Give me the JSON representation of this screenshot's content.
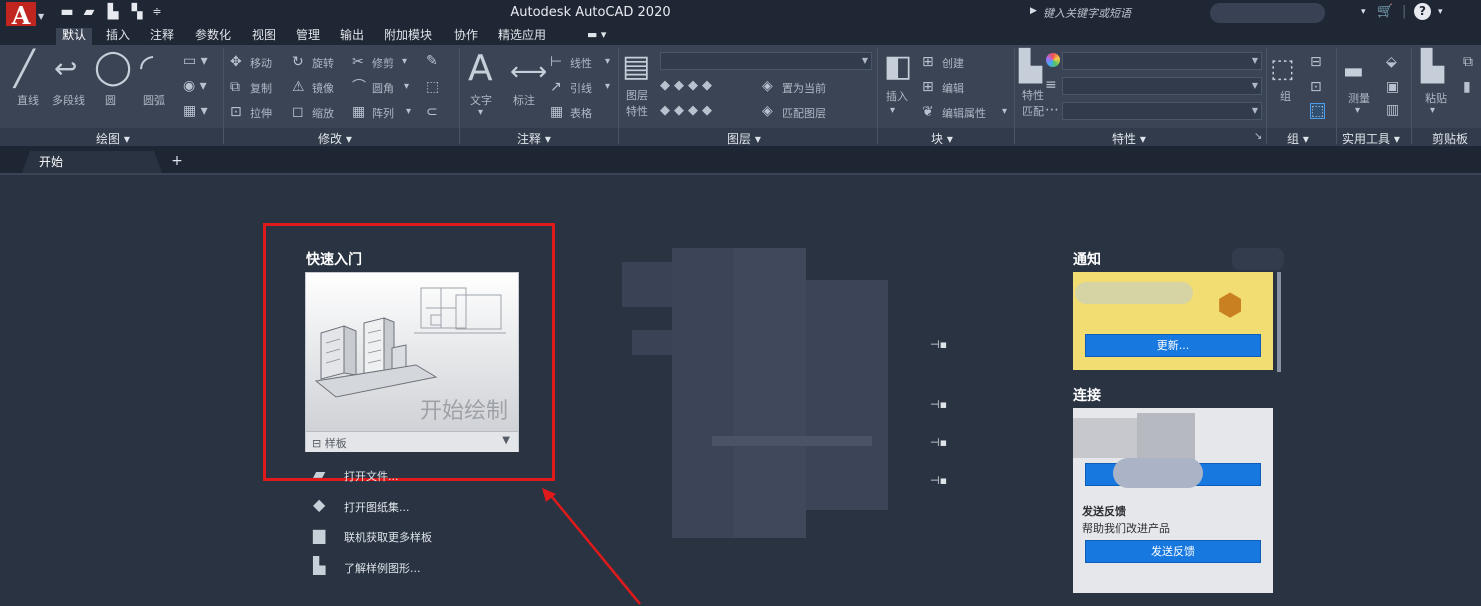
{
  "app": {
    "logo_letter": "A",
    "title": "Autodesk AutoCAD 2020",
    "search_placeholder": "键入关键字或短语"
  },
  "ribbon_tabs": [
    "默认",
    "插入",
    "注释",
    "参数化",
    "视图",
    "管理",
    "输出",
    "附加模块",
    "协作",
    "精选应用"
  ],
  "ribbon": {
    "draw": {
      "title": "绘图 ▾",
      "items": [
        "直线",
        "多段线",
        "圆",
        "圆弧"
      ]
    },
    "modify": {
      "title": "修改 ▾",
      "items": [
        "移动",
        "旋转",
        "修剪",
        "复制",
        "镜像",
        "圆角",
        "拉伸",
        "缩放",
        "阵列"
      ]
    },
    "annotation": {
      "title": "注释 ▾",
      "items": [
        "文字",
        "标注",
        "线性",
        "引线",
        "表格"
      ]
    },
    "layers": {
      "title": "图层 ▾",
      "items": [
        "图层特性",
        "置为当前",
        "匹配图层"
      ]
    },
    "block": {
      "title": "块 ▾",
      "items": [
        "插入",
        "创建",
        "编辑",
        "编辑属性"
      ]
    },
    "properties": {
      "title": "特性 ▾",
      "items": [
        "特性匹配"
      ]
    },
    "groups": {
      "title": "组 ▾",
      "items": [
        "组"
      ]
    },
    "utilities": {
      "title": "实用工具 ▾",
      "items": [
        "测量"
      ]
    },
    "clipboard": {
      "title": "剪贴板",
      "items": [
        "粘贴"
      ]
    }
  },
  "doc_tab": {
    "label": "开始",
    "add": "+"
  },
  "start": {
    "section_title": "快速入门",
    "start_drawing": "开始绘制",
    "template_label": "样板",
    "links": [
      "打开文件...",
      "打开图纸集...",
      "联机获取更多样板",
      "了解样例图形..."
    ]
  },
  "right_panel": {
    "notice_title": "通知",
    "update_button": "更新...",
    "connect_title": "连接",
    "feedback_title": "发送反馈",
    "feedback_sub": "帮助我们改进产品",
    "feedback_button": "发送反馈"
  },
  "colors": {
    "title_bar": "#202734",
    "ribbon": "#3b4455",
    "canvas": "#2a3342",
    "highlight_red": "#e01a1a",
    "button_blue": "#1778e0",
    "notice_yellow": "#f1dd72"
  }
}
